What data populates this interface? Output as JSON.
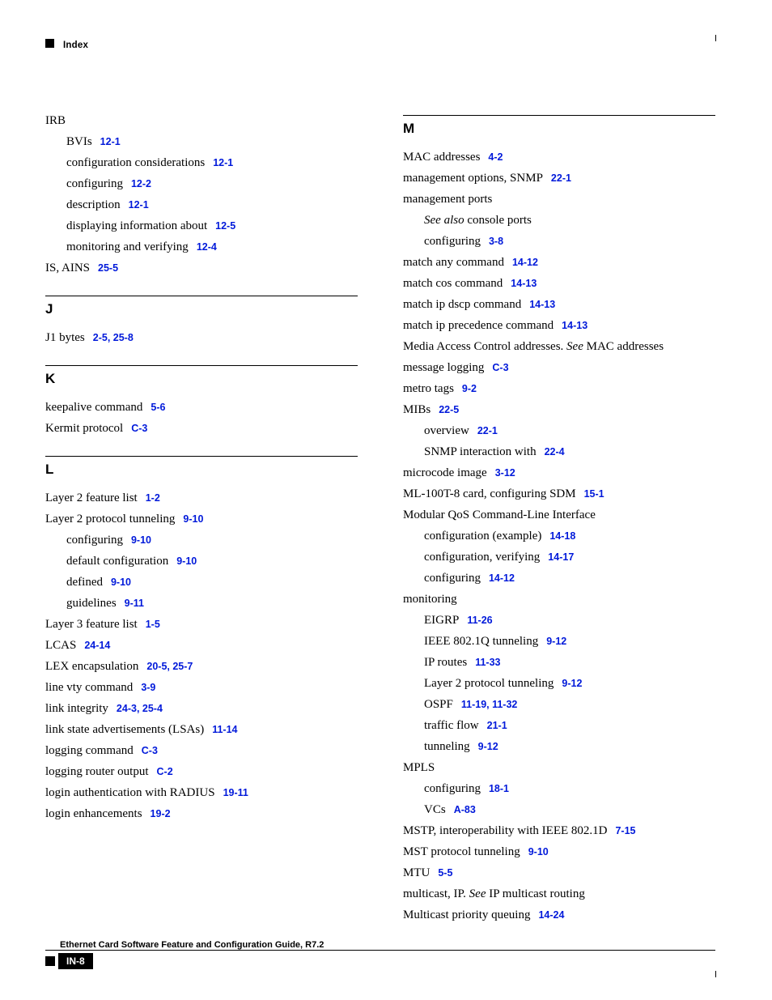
{
  "header": {
    "section": "Index"
  },
  "footer": {
    "page_num": "IN-8",
    "doc_title": "Ethernet Card Software Feature and Configuration Guide, R7.2"
  },
  "left": {
    "irb": {
      "title": "IRB",
      "items": [
        {
          "text": "BVIs",
          "refs": [
            "12-1"
          ]
        },
        {
          "text": "configuration considerations",
          "refs": [
            "12-1"
          ]
        },
        {
          "text": "configuring",
          "refs": [
            "12-2"
          ]
        },
        {
          "text": "description",
          "refs": [
            "12-1"
          ]
        },
        {
          "text": "displaying information about",
          "refs": [
            "12-5"
          ]
        },
        {
          "text": "monitoring and verifying",
          "refs": [
            "12-4"
          ]
        }
      ]
    },
    "is_ains": {
      "text": "IS, AINS",
      "refs": [
        "25-5"
      ]
    },
    "J": {
      "letter": "J",
      "items": [
        {
          "text": "J1 bytes",
          "refs": [
            "2-5, 25-8"
          ]
        }
      ]
    },
    "K": {
      "letter": "K",
      "items": [
        {
          "text": "keepalive command",
          "refs": [
            "5-6"
          ]
        },
        {
          "text": "Kermit protocol",
          "refs": [
            "C-3"
          ]
        }
      ]
    },
    "L": {
      "letter": "L",
      "items": [
        {
          "text": "Layer 2 feature list",
          "refs": [
            "1-2"
          ],
          "sub": []
        },
        {
          "text": "Layer 2 protocol tunneling",
          "refs": [
            "9-10"
          ],
          "sub": [
            {
              "text": "configuring",
              "refs": [
                "9-10"
              ]
            },
            {
              "text": "default configuration",
              "refs": [
                "9-10"
              ]
            },
            {
              "text": "defined",
              "refs": [
                "9-10"
              ]
            },
            {
              "text": "guidelines",
              "refs": [
                "9-11"
              ]
            }
          ]
        },
        {
          "text": "Layer 3 feature list",
          "refs": [
            "1-5"
          ],
          "sub": []
        },
        {
          "text": "LCAS",
          "refs": [
            "24-14"
          ],
          "sub": []
        },
        {
          "text": "LEX encapsulation",
          "refs": [
            "20-5, 25-7"
          ],
          "sub": []
        },
        {
          "text": "line vty command",
          "refs": [
            "3-9"
          ],
          "sub": []
        },
        {
          "text": "link integrity",
          "refs": [
            "24-3, 25-4"
          ],
          "sub": []
        },
        {
          "text": "link state advertisements (LSAs)",
          "refs": [
            "11-14"
          ],
          "sub": []
        },
        {
          "text": "logging command",
          "refs": [
            "C-3"
          ],
          "sub": []
        },
        {
          "text": "logging router output",
          "refs": [
            "C-2"
          ],
          "sub": []
        },
        {
          "text": "login authentication with RADIUS",
          "refs": [
            "19-11"
          ],
          "sub": []
        },
        {
          "text": "login enhancements",
          "refs": [
            "19-2"
          ],
          "sub": []
        }
      ]
    }
  },
  "right": {
    "M": {
      "letter": "M",
      "mac": {
        "text": "MAC addresses",
        "refs": [
          "4-2"
        ]
      },
      "mgmt_snmp": {
        "text": "management options, SNMP",
        "refs": [
          "22-1"
        ]
      },
      "mgmt_ports": {
        "text": "management ports",
        "see_also_prefix": "See also",
        "see_also_rest": " console ports",
        "configuring": {
          "text": "configuring",
          "refs": [
            "3-8"
          ]
        }
      },
      "match_any": {
        "text": "match any command",
        "refs": [
          "14-12"
        ]
      },
      "match_cos": {
        "text": "match cos command",
        "refs": [
          "14-13"
        ]
      },
      "match_ip_dscp": {
        "text": "match ip dscp command",
        "refs": [
          "14-13"
        ]
      },
      "match_ip_prec": {
        "text": "match ip precedence command",
        "refs": [
          "14-13"
        ]
      },
      "media_access": {
        "pre": "Media Access Control addresses. ",
        "see": "See",
        "post": " MAC addresses"
      },
      "msg_logging": {
        "text": "message logging",
        "refs": [
          "C-3"
        ]
      },
      "metro_tags": {
        "text": "metro tags",
        "refs": [
          "9-2"
        ]
      },
      "mibs": {
        "text": "MIBs",
        "refs": [
          "22-5"
        ],
        "overview": {
          "text": "overview",
          "refs": [
            "22-1"
          ]
        },
        "snmp_int": {
          "text": "SNMP interaction with",
          "refs": [
            "22-4"
          ]
        }
      },
      "microcode": {
        "text": "microcode image",
        "refs": [
          "3-12"
        ]
      },
      "ml100t8": {
        "text": "ML-100T-8 card, configuring SDM",
        "refs": [
          "15-1"
        ]
      },
      "mqc": {
        "text": "Modular QoS Command-Line Interface",
        "cfg_ex": {
          "text": "configuration (example)",
          "refs": [
            "14-18"
          ]
        },
        "cfg_ver": {
          "text": "configuration, verifying",
          "refs": [
            "14-17"
          ]
        },
        "cfg": {
          "text": "configuring",
          "refs": [
            "14-12"
          ]
        }
      },
      "monitoring": {
        "text": "monitoring",
        "eigrp": {
          "text": "EIGRP",
          "refs": [
            "11-26"
          ]
        },
        "ieee": {
          "text": "IEEE 802.1Q tunneling",
          "refs": [
            "9-12"
          ]
        },
        "ip_routes": {
          "text": "IP routes",
          "refs": [
            "11-33"
          ]
        },
        "l2pt": {
          "text": "Layer 2 protocol tunneling",
          "refs": [
            "9-12"
          ]
        },
        "ospf": {
          "text": "OSPF",
          "refs": [
            "11-19, 11-32"
          ]
        },
        "traffic": {
          "text": "traffic flow",
          "refs": [
            "21-1"
          ]
        },
        "tunneling": {
          "text": "tunneling",
          "refs": [
            "9-12"
          ]
        }
      },
      "mpls": {
        "text": "MPLS",
        "cfg": {
          "text": "configuring",
          "refs": [
            "18-1"
          ]
        },
        "vcs": {
          "text": "VCs",
          "refs": [
            "A-83"
          ]
        }
      },
      "mstp": {
        "text": "MSTP, interoperability with IEEE 802.1D",
        "refs": [
          "7-15"
        ]
      },
      "mst_pt": {
        "text": "MST protocol tunneling",
        "refs": [
          "9-10"
        ]
      },
      "mtu": {
        "text": "MTU",
        "refs": [
          "5-5"
        ]
      },
      "multicast_ip": {
        "pre": "multicast, IP. ",
        "see": "See",
        "post": " IP multicast routing"
      },
      "multicast_pq": {
        "text": "Multicast priority queuing",
        "refs": [
          "14-24"
        ]
      }
    }
  }
}
